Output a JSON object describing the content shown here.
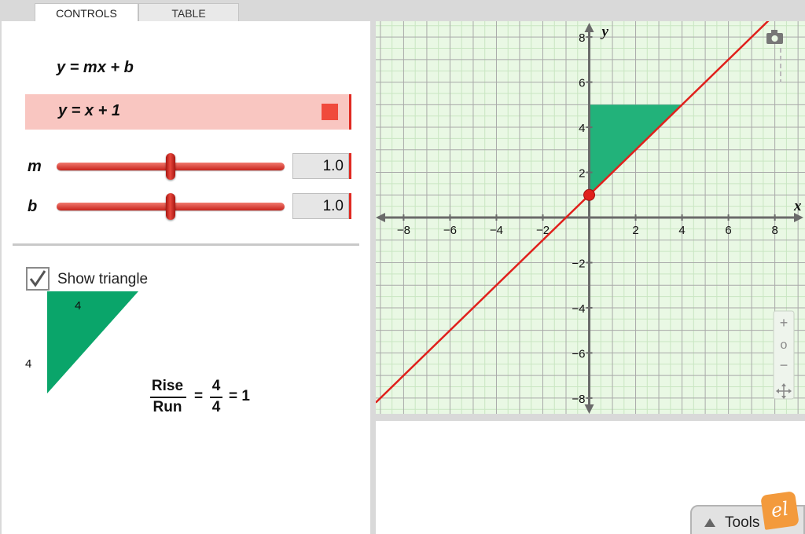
{
  "tabs": [
    {
      "label": "CONTROLS",
      "active": true
    },
    {
      "label": "TABLE",
      "active": false
    }
  ],
  "equation": {
    "general": "y = mx + b",
    "current": "y = x + 1",
    "color": "#f04a3c"
  },
  "sliders": [
    {
      "name": "m",
      "value": "1.0",
      "level": 0.5
    },
    {
      "name": "b",
      "value": "1.0",
      "level": 0.5
    }
  ],
  "triangle": {
    "checkbox_label": "Show triangle",
    "checked": true,
    "run": "4",
    "rise": "4",
    "fill": "#0aa56a",
    "formula": {
      "rise_word": "Rise",
      "run_word": "Run",
      "numerator": "4",
      "denominator": "4",
      "result": "= 1",
      "eq": "="
    }
  },
  "graph": {
    "x_label": "x",
    "y_label": "y",
    "x_min": -9.2,
    "x_max": 9.3,
    "y_min": -8.7,
    "y_max": 8.7,
    "x_ticks": [
      {
        "v": -8,
        "label": "−8"
      },
      {
        "v": -6,
        "label": "−6"
      },
      {
        "v": -4,
        "label": "−4"
      },
      {
        "v": -2,
        "label": "−2"
      },
      {
        "v": 2,
        "label": "2"
      },
      {
        "v": 4,
        "label": "4"
      },
      {
        "v": 6,
        "label": "6"
      },
      {
        "v": 8,
        "label": "8"
      }
    ],
    "y_ticks": [
      {
        "v": 8,
        "label": "8"
      },
      {
        "v": 6,
        "label": "6"
      },
      {
        "v": 4,
        "label": "4"
      },
      {
        "v": 2,
        "label": "2"
      },
      {
        "v": -2,
        "label": "−2"
      },
      {
        "v": -4,
        "label": "−4"
      },
      {
        "v": -6,
        "label": "−6"
      },
      {
        "v": -8,
        "label": "−8"
      }
    ],
    "line": {
      "m": 1,
      "b": 1,
      "color": "#e0201c"
    },
    "point": {
      "x": 0,
      "y": 1
    },
    "triangle_points": [
      [
        0,
        1
      ],
      [
        0,
        5
      ],
      [
        4,
        5
      ]
    ],
    "triangle_color": "#22b27a",
    "zoom_in": "+",
    "zoom_reset": "o",
    "zoom_out": "−"
  },
  "tools": {
    "label": "Tools"
  },
  "logo": {
    "text": "el"
  }
}
